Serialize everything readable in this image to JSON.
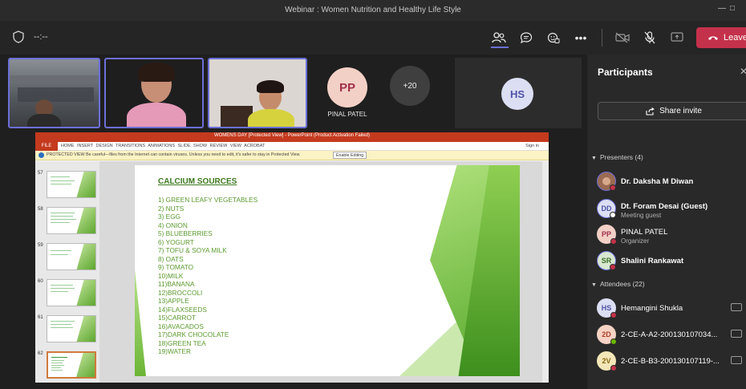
{
  "window": {
    "title": "Webinar : Women Nutrition and Healthy Life Style"
  },
  "toolbar": {
    "timer": "--:--",
    "leave_label": "Leave"
  },
  "video": {
    "pinal_initials": "PP",
    "pinal_name": "PINAL PATEL",
    "more_count": "+20",
    "hs_initials": "HS"
  },
  "ppt": {
    "title": "WOMENS DAY [Protected View] - PowerPoint (Product Activation Failed)",
    "file_tab": "FILE",
    "menu": "HOME INSERT DESIGN TRANSITIONS ANIMATIONS SLIDE SHOW REVIEW VIEW ACROBAT",
    "signin": "Sign in",
    "warning": "PROTECTED VIEW Be careful—files from the Internet can contain viruses. Unless you need to edit, it's safer to stay in Protected View.",
    "enable_label": "Enable Editing",
    "thumb_numbers": [
      "57",
      "58",
      "59",
      "60",
      "61",
      "62"
    ],
    "slide_heading": "CALCIUM SOURCES",
    "slide_items": [
      "1)  GREEN LEAFY VEGETABLES",
      "2)  NUTS",
      "3)  EGG",
      "4)  ONION",
      "5)  BLUEBERRIES",
      "6)  YOGURT",
      "7)  TOFU & SOYA MILK",
      "8)  OATS",
      "9)  TOMATO",
      "10)MILK",
      "11)BANANA",
      "12)BROCCOLI",
      "13)APPLE",
      "14)FLAXSEEDS",
      "15)CARROT",
      "16)AVACADOS",
      "17)DARK CHOCOLATE",
      "18)GREEN TEA",
      "19)WATER"
    ]
  },
  "participants": {
    "title": "Participants",
    "share_invite": "Share invite",
    "presenters_header": "Presenters (4)",
    "attendees_header": "Attendees (22)",
    "presenters": [
      {
        "initials": "",
        "name": "Dr. Daksha M Diwan",
        "role": ""
      },
      {
        "initials": "DD",
        "name": "Dt. Foram Desai (Guest)",
        "role": "Meeting guest"
      },
      {
        "initials": "PP",
        "name": "PINAL PATEL",
        "role": "Organizer"
      },
      {
        "initials": "SR",
        "name": "Shalini Rankawat",
        "role": ""
      }
    ],
    "attendees": [
      {
        "initials": "HS",
        "name": "Hemangini Shukla"
      },
      {
        "initials": "2D",
        "name": "2-CE-A-A2-200130107034..."
      },
      {
        "initials": "2V",
        "name": "2-CE-B-B3-200130107119-..."
      }
    ]
  },
  "colors": {
    "leave": "#c4314b",
    "accent": "#6c6fd8",
    "slide_text": "#5b9a2e"
  }
}
